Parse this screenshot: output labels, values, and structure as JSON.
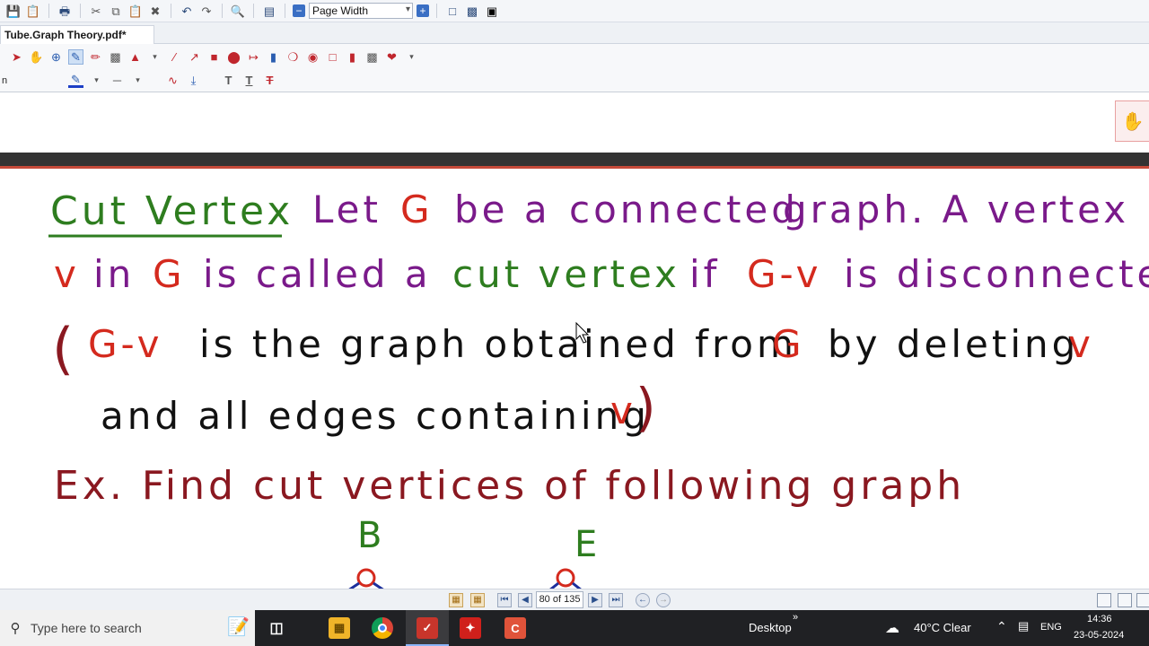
{
  "toolbar": {
    "zoom_value": "Page Width"
  },
  "tab": {
    "document_title": "Tube.Graph Theory.pdf*"
  },
  "toolbar3": {
    "left_fragment": "n"
  },
  "slide": {
    "heading": "Cut Vertex",
    "line1_parts": [
      "Let",
      "G",
      "be a",
      "connected",
      "graph. A vertex"
    ],
    "line2_parts": [
      "v",
      "in",
      "G",
      "is called a",
      "cut vertex",
      "if",
      "G-v",
      "is disconnected."
    ],
    "line3_parts": [
      "(",
      "G-v",
      "is the graph obtained from",
      "G",
      "by deleting",
      "v"
    ],
    "line4_parts": [
      "and all edges containing",
      "v",
      ")"
    ],
    "example": "Ex. Find cut vertices of following graph",
    "vertex_labels": [
      "B",
      "E"
    ],
    "colors": {
      "green": "#2e7d1f",
      "purple": "#7a1a8a",
      "red": "#d42a1e",
      "black": "#111111",
      "maroon": "#8a1820"
    }
  },
  "nav": {
    "page_indicator": "80 of 135"
  },
  "taskbar": {
    "search_placeholder": "Type here to search",
    "desktop_label": "Desktop",
    "weather": "40°C Clear",
    "language": "ENG",
    "time": "14:36",
    "date": "23-05-2024"
  }
}
